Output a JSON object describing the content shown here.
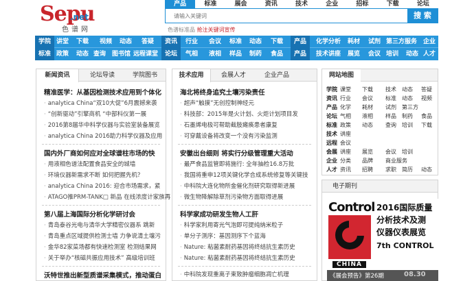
{
  "logo": {
    "mark": "Sepu",
    "domain": ".net",
    "cn": "色谱网"
  },
  "top_tabs": [
    "产品",
    "标准",
    "展会",
    "资讯",
    "技术",
    "企业",
    "招标",
    "下载",
    "论坛"
  ],
  "search": {
    "placeholder": "请输入关键词",
    "button": "搜 索"
  },
  "promo": {
    "prefix": "色谱标准品",
    "hot": "抢注关键词宣传"
  },
  "nav": {
    "row1": [
      [
        "学院",
        56
      ],
      [
        "讲堂",
        82
      ],
      [
        "下载",
        111
      ],
      [
        "视频",
        145
      ],
      [
        "动态",
        174
      ],
      [
        "答疑",
        206
      ],
      [
        "资讯",
        240
      ],
      [
        "行业",
        270
      ],
      [
        "会议",
        304
      ],
      [
        "标准",
        334
      ],
      [
        "动态",
        363
      ],
      [
        "下载",
        394
      ],
      [
        "产品",
        428
      ],
      [
        "化学分析",
        460
      ],
      [
        "耗材",
        506
      ],
      [
        "试剂",
        536
      ],
      [
        "第三方服务",
        562
      ],
      [
        "企业",
        616
      ]
    ],
    "row2": [
      [
        "标准",
        56
      ],
      [
        "政策",
        82
      ],
      [
        "动态",
        111
      ],
      [
        "查询",
        136
      ],
      [
        "图书馆",
        163
      ],
      [
        "远程课堂",
        194
      ],
      [
        "论坛",
        240
      ],
      [
        "气相",
        270
      ],
      [
        "液相",
        304
      ],
      [
        "样品",
        334
      ],
      [
        "制药",
        363
      ],
      [
        "食品",
        394
      ],
      [
        "产品",
        428
      ],
      [
        "技术讲座",
        460
      ],
      [
        "展览",
        506
      ],
      [
        "会议",
        536
      ],
      [
        "培训",
        562
      ],
      [
        "动态",
        591
      ],
      [
        "人才",
        616
      ]
    ]
  },
  "news": {
    "tabs": [
      "新闻资讯",
      "论坛导读",
      "学院图书"
    ],
    "headlines": [
      "精准医学：从基因检测技术应用到个体化",
      "国内外厂商如何应对全球谱柱市场的快",
      "第八届上海国际分析化学研讨会",
      "沃特世推出新型质谱采集模式，推动蛋白"
    ],
    "group1": [
      "analytica China“双10大促”6月震撼来袭",
      "“创新驱动”引擎商机 “中部科仪第一展",
      "2016第8届华中科学仪器与实验室装备展览",
      "analytica China 2016助力科学仪器及应用"
    ],
    "group2": [
      "用液相色谱法配置食品安全的城墙",
      "环境仪器新需求不断 如何把握先机？",
      "analytica China 2016: 迎合市场需求，紧",
      "ATAGO推PRM-TANK□ 新品 在线浓度计家族再"
    ],
    "group3": [
      "青岛泰谷光电与清华大学精密仪器系 跳新",
      "青岛重点区域提供检测士墙 力争说清土壤污",
      "金华82家菜场都有快速检测室 检测结果网",
      "关于举办“核磁共振应用技术” 高级培训班"
    ]
  },
  "tech": {
    "tabs": [
      "技术应用",
      "会展人才",
      "企业产品"
    ],
    "headlines": [
      "海北将终身追究土壤污染责任",
      "安徽出台细则 将实行分级管理重大活动",
      "科学家成功研发生物人工肝"
    ],
    "group1": [
      "超声“触摸”无创控制神经元",
      "科技部：2015年是火计划、火炬计划项目发",
      "石墨烯电极可帮助截肢瘫痪患者康复",
      "可穿戴设备将改变一个没有污染监测"
    ],
    "group2": [
      "最严食品监管即将施行: 全年抽检16.8万批",
      "我国将重申12项关键化学合成系统修复等关键技",
      "中科院大连化物所金催化剂研究取得新进展",
      "微生物降解除草剂污染物方面取得进展"
    ],
    "group3": [
      "科学家利用寄光气泡即可提纯纳米粒子",
      "单分子测序：基因测序下个蓝海",
      "Nature: 粘菌素耐药基因将终结抗生素历史",
      "Nature: 粘菌素耐药基因将终结抗生素历史"
    ],
    "last": "中科院发现重离子束致肿瘤细胞凋亡机理"
  },
  "sitemap": {
    "title": "网站地图",
    "rows": [
      [
        "学院",
        "课堂",
        "下载",
        "技术",
        "动态",
        "答疑"
      ],
      [
        "资讯",
        "行业",
        "会议",
        "标准",
        "动态",
        "视频"
      ],
      [
        "产品",
        "化学",
        "耗材",
        "试剂",
        "第三方",
        ""
      ],
      [
        "论坛",
        "气相",
        "液相",
        "样品",
        "制药",
        "食品"
      ],
      [
        "标准",
        "政策",
        "动态",
        "查询",
        "培训",
        "下载"
      ],
      [
        "技术",
        "讲座",
        "",
        "",
        "",
        ""
      ],
      [
        "远程",
        "会议",
        "",
        "",
        "",
        ""
      ],
      [
        "会展",
        "讲座",
        "展览",
        "会议",
        "培训",
        ""
      ],
      [
        "企业",
        "分类",
        "品牌",
        "商业服务",
        ""
      ],
      [
        "人才",
        "资讯",
        "招聘",
        "求职",
        "简历",
        "动态"
      ]
    ]
  },
  "ejournal": {
    "title": "电子期刊"
  },
  "banner": {
    "word": "Control",
    "country": "CHINA",
    "line1": "2016国际质量",
    "line2": "分析技术及测",
    "line3": "仪器仪表展览",
    "line4": "7th CONTROL",
    "caption": "《展会预告》第26期",
    "date": "08.30",
    "colors": {
      "red": "#d22630",
      "dark": "#111111"
    }
  },
  "colors": {
    "primary": "#1e8fd6",
    "brand_red": "#c8262c"
  }
}
